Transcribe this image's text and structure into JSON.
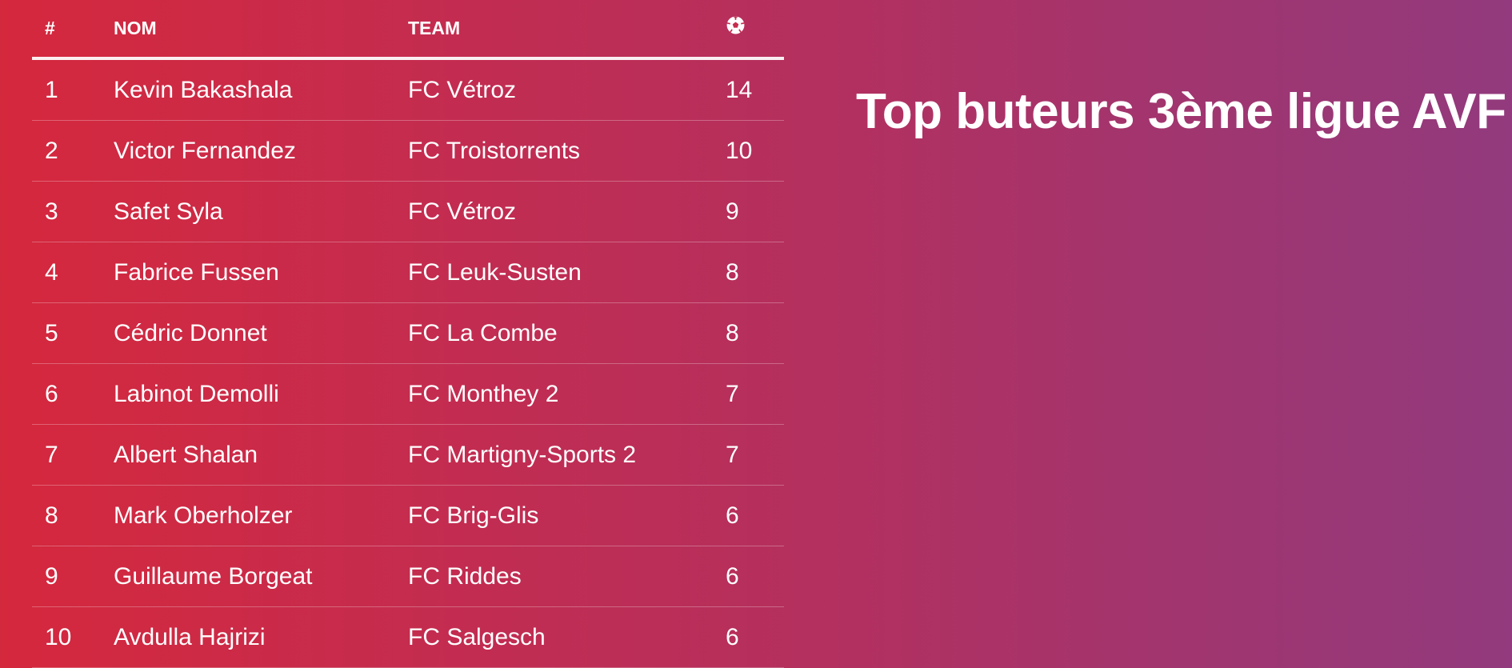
{
  "page": {
    "title": "Top buteurs 3ème ligue AVF"
  },
  "table": {
    "headers": {
      "rank": "#",
      "name": "NOM",
      "team": "TEAM",
      "goals_icon": "soccer-ball-icon"
    },
    "rows": [
      {
        "rank": "1",
        "name": "Kevin Bakashala",
        "team": "FC Vétroz",
        "goals": "14"
      },
      {
        "rank": "2",
        "name": "Victor Fernandez",
        "team": "FC Troistorrents",
        "goals": "10"
      },
      {
        "rank": "3",
        "name": "Safet Syla",
        "team": "FC Vétroz",
        "goals": "9"
      },
      {
        "rank": "4",
        "name": "Fabrice Fussen",
        "team": "FC Leuk-Susten",
        "goals": "8"
      },
      {
        "rank": "5",
        "name": "Cédric Donnet",
        "team": "FC La Combe",
        "goals": "8"
      },
      {
        "rank": "6",
        "name": "Labinot Demolli",
        "team": "FC Monthey 2",
        "goals": "7"
      },
      {
        "rank": "7",
        "name": "Albert Shalan",
        "team": "FC Martigny-Sports 2",
        "goals": "7"
      },
      {
        "rank": "8",
        "name": "Mark Oberholzer",
        "team": "FC Brig-Glis",
        "goals": "6"
      },
      {
        "rank": "9",
        "name": "Guillaume Borgeat",
        "team": "FC Riddes",
        "goals": "6"
      },
      {
        "rank": "10",
        "name": "Avdulla Hajrizi",
        "team": "FC Salgesch",
        "goals": "6"
      }
    ]
  },
  "colors": {
    "background_left": "#d5283d",
    "background_right": "#923a7d",
    "text": "#ffffff"
  }
}
